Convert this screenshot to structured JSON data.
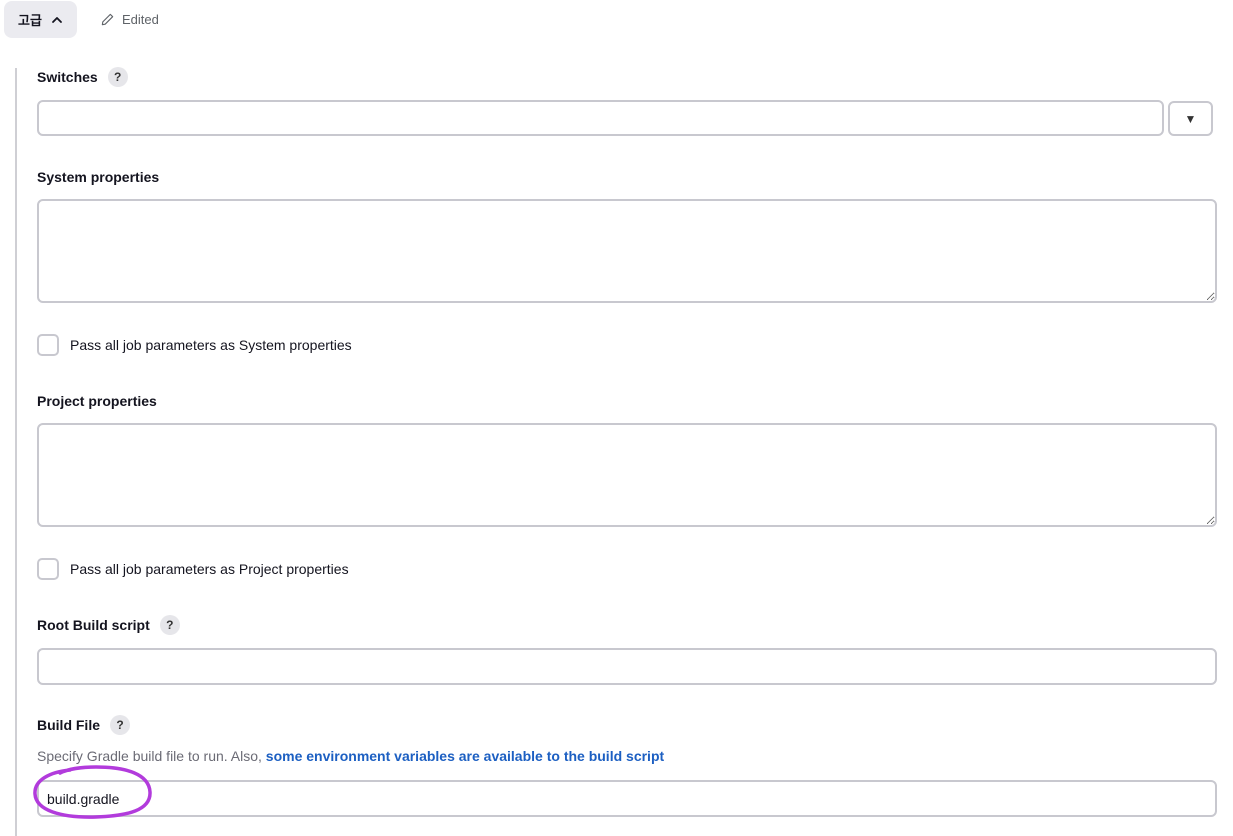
{
  "toolbar": {
    "advanced_label": "고급",
    "edited_label": "Edited"
  },
  "fields": {
    "switches": {
      "label": "Switches",
      "value": ""
    },
    "system_properties": {
      "label": "System properties",
      "value": ""
    },
    "pass_system": {
      "label": "Pass all job parameters as System properties"
    },
    "project_properties": {
      "label": "Project properties",
      "value": ""
    },
    "pass_project": {
      "label": "Pass all job parameters as Project properties"
    },
    "root_build_script": {
      "label": "Root Build script",
      "value": ""
    },
    "build_file": {
      "label": "Build File",
      "description": "Specify Gradle build file to run. Also,",
      "link_text": "some environment variables are available to the build script",
      "value": "build.gradle"
    }
  },
  "help_symbol": "?",
  "dropdown_symbol": "▼",
  "colors": {
    "annotation": "#b23bdc",
    "link": "#1c5fc2"
  },
  "icons": {
    "advanced_toggle": "chevron-up-icon",
    "edited": "pencil-icon"
  }
}
